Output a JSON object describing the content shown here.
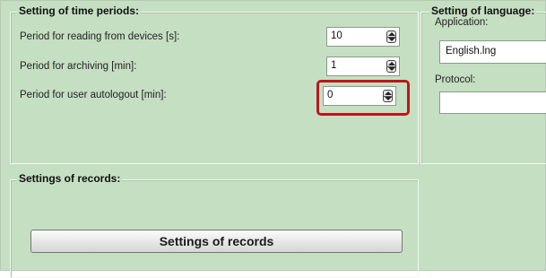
{
  "time_periods": {
    "title": "Setting of time periods:",
    "rows": [
      {
        "label": "Period for reading from devices [s]:",
        "value": "10"
      },
      {
        "label": "Period for archiving [min]:",
        "value": "1"
      },
      {
        "label": "Period for user autologout [min]:",
        "value": "0"
      }
    ]
  },
  "language": {
    "title": "Setting of language:",
    "application_label": "Application:",
    "application_value": "English.lng",
    "protocol_label": "Protocol:",
    "protocol_value": ""
  },
  "records": {
    "title": "Settings of records:",
    "button_label": "Settings of records"
  },
  "colors": {
    "panel_background": "#c5dfc2",
    "highlight": "#c0141b"
  },
  "icons": [
    "spinner-arrows-icon"
  ]
}
